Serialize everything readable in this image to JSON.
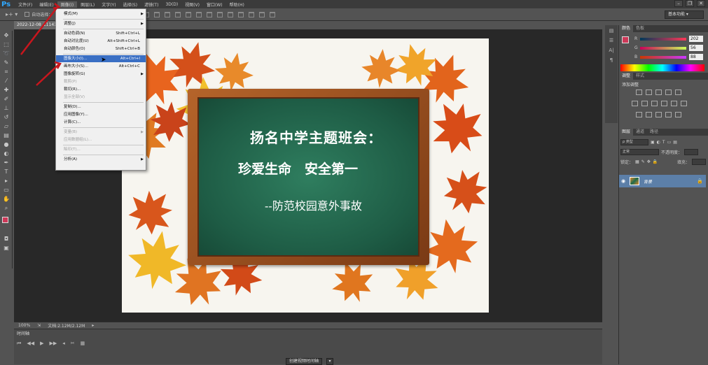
{
  "app": {
    "logo": "Ps"
  },
  "menubar": [
    {
      "label": "文件(F)"
    },
    {
      "label": "编辑(E)"
    },
    {
      "label": "图像(I)"
    },
    {
      "label": "图层(L)"
    },
    {
      "label": "文字(Y)"
    },
    {
      "label": "选择(S)"
    },
    {
      "label": "滤镜(T)"
    },
    {
      "label": "3D(D)"
    },
    {
      "label": "视图(V)"
    },
    {
      "label": "窗口(W)"
    },
    {
      "label": "帮助(H)"
    }
  ],
  "options_bar": {
    "auto_select_label": "自动选择：",
    "workspace": "基本功能"
  },
  "document_tab": "2022-12-08_11141...",
  "image_menu": {
    "items": [
      {
        "label": "模式(M)",
        "shortcut": "",
        "submenu": true,
        "disabled": false,
        "highlighted": false
      },
      {
        "label": "调整(J)",
        "shortcut": "",
        "submenu": true,
        "disabled": false,
        "highlighted": false,
        "sep_before": true
      },
      {
        "label": "自动色调(N)",
        "shortcut": "Shift+Ctrl+L",
        "submenu": false,
        "disabled": false,
        "highlighted": false,
        "sep_before": true
      },
      {
        "label": "自动对比度(U)",
        "shortcut": "Alt+Shift+Ctrl+L",
        "submenu": false,
        "disabled": false,
        "highlighted": false
      },
      {
        "label": "自动颜色(O)",
        "shortcut": "Shift+Ctrl+B",
        "submenu": false,
        "disabled": false,
        "highlighted": false
      },
      {
        "label": "图像大小(I)...",
        "shortcut": "Alt+Ctrl+I",
        "submenu": false,
        "disabled": false,
        "highlighted": true,
        "sep_before": true
      },
      {
        "label": "画布大小(S)...",
        "shortcut": "Alt+Ctrl+C",
        "submenu": false,
        "disabled": false,
        "highlighted": false
      },
      {
        "label": "图像旋转(G)",
        "shortcut": "",
        "submenu": true,
        "disabled": false,
        "highlighted": false
      },
      {
        "label": "裁剪(P)",
        "shortcut": "",
        "submenu": false,
        "disabled": true,
        "highlighted": false
      },
      {
        "label": "裁切(R)...",
        "shortcut": "",
        "submenu": false,
        "disabled": false,
        "highlighted": false
      },
      {
        "label": "显示全部(V)",
        "shortcut": "",
        "submenu": false,
        "disabled": true,
        "highlighted": false
      },
      {
        "label": "复制(D)...",
        "shortcut": "",
        "submenu": false,
        "disabled": false,
        "highlighted": false,
        "sep_before": true
      },
      {
        "label": "应用图像(Y)...",
        "shortcut": "",
        "submenu": false,
        "disabled": false,
        "highlighted": false
      },
      {
        "label": "计算(C)...",
        "shortcut": "",
        "submenu": false,
        "disabled": false,
        "highlighted": false
      },
      {
        "label": "变量(B)",
        "shortcut": "",
        "submenu": true,
        "disabled": true,
        "highlighted": false,
        "sep_before": true
      },
      {
        "label": "应用数据组(L)...",
        "shortcut": "",
        "submenu": false,
        "disabled": true,
        "highlighted": false
      },
      {
        "label": "陷印(T)...",
        "shortcut": "",
        "submenu": false,
        "disabled": true,
        "highlighted": false,
        "sep_before": true
      },
      {
        "label": "分析(A)",
        "shortcut": "",
        "submenu": true,
        "disabled": false,
        "highlighted": false,
        "sep_before": true
      }
    ]
  },
  "canvas": {
    "line1": "扬名中学主题班会：",
    "line2": "珍爱生命　安全第一",
    "line3": "--防范校园意外事故"
  },
  "status": {
    "zoom": "100%",
    "doc_size": "文档:2.12M/2.12M"
  },
  "timeline": {
    "title": "时间轴",
    "create_button": "创建视频时间轴"
  },
  "color_panel": {
    "tabs": [
      "颜色",
      "色板"
    ],
    "fg_color": "#cd3858",
    "r": {
      "label": "R",
      "value": "202"
    },
    "g": {
      "label": "G",
      "value": "56"
    },
    "b": {
      "label": "B",
      "value": "88"
    }
  },
  "adjustments_panel": {
    "tabs": [
      "调整",
      "样式"
    ],
    "title": "添加调整"
  },
  "layers_panel": {
    "tabs": [
      "图层",
      "通道",
      "路径"
    ],
    "filter_label": "ρ 类型",
    "blend_mode": "正常",
    "opacity_label": "不透明度：",
    "lock_label": "锁定：",
    "fill_label": "填充：",
    "layer_name": "背景"
  }
}
